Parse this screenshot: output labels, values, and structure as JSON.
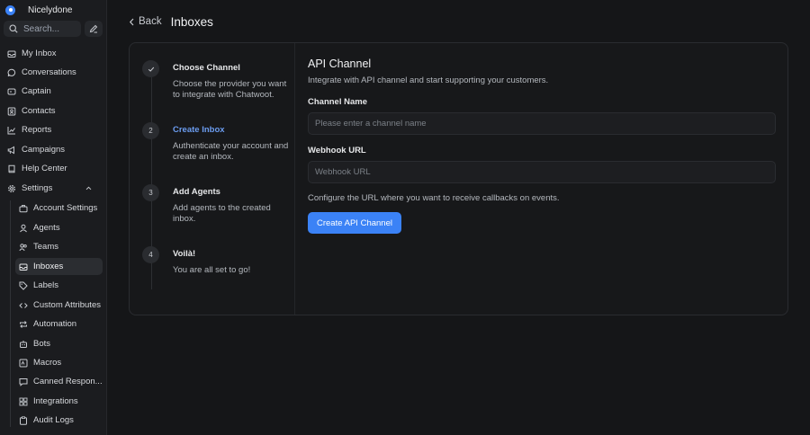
{
  "sidebar": {
    "brand_name": "Nicelydone",
    "search_placeholder": "Search...",
    "nav": [
      {
        "label": "My Inbox",
        "icon": "inbox-icon"
      },
      {
        "label": "Conversations",
        "icon": "chat-icon"
      },
      {
        "label": "Captain",
        "icon": "captain-icon"
      },
      {
        "label": "Contacts",
        "icon": "contacts-icon"
      },
      {
        "label": "Reports",
        "icon": "reports-icon"
      },
      {
        "label": "Campaigns",
        "icon": "megaphone-icon"
      },
      {
        "label": "Help Center",
        "icon": "book-icon"
      },
      {
        "label": "Settings",
        "icon": "gear-icon"
      }
    ],
    "settings_items": [
      {
        "label": "Account Settings",
        "icon": "briefcase-icon"
      },
      {
        "label": "Agents",
        "icon": "user-icon"
      },
      {
        "label": "Teams",
        "icon": "users-icon"
      },
      {
        "label": "Inboxes",
        "icon": "inbox-tray-icon"
      },
      {
        "label": "Labels",
        "icon": "tag-icon"
      },
      {
        "label": "Custom Attributes",
        "icon": "code-icon"
      },
      {
        "label": "Automation",
        "icon": "repeat-icon"
      },
      {
        "label": "Bots",
        "icon": "bot-icon"
      },
      {
        "label": "Macros",
        "icon": "macro-icon"
      },
      {
        "label": "Canned Respon...",
        "icon": "message-icon"
      },
      {
        "label": "Integrations",
        "icon": "grid-icon"
      },
      {
        "label": "Audit Logs",
        "icon": "clipboard-icon"
      }
    ],
    "active_item": "Inboxes"
  },
  "header": {
    "back_label": "Back",
    "title": "Inboxes"
  },
  "steps": [
    {
      "number": "",
      "title": "Choose Channel",
      "description": "Choose the provider you want to integrate with Chatwoot.",
      "state": "done"
    },
    {
      "number": "2",
      "title": "Create Inbox",
      "description": "Authenticate your account and create an inbox.",
      "state": "active"
    },
    {
      "number": "3",
      "title": "Add Agents",
      "description": "Add agents to the created inbox.",
      "state": "pending"
    },
    {
      "number": "4",
      "title": "Voilà!",
      "description": "You are all set to go!",
      "state": "pending"
    }
  ],
  "form": {
    "title": "API Channel",
    "subtitle": "Integrate with API channel and start supporting your customers.",
    "channel_name_label": "Channel Name",
    "channel_name_placeholder": "Please enter a channel name",
    "channel_name_value": "",
    "webhook_label": "Webhook URL",
    "webhook_placeholder": "Webhook URL",
    "webhook_value": "",
    "webhook_help": "Configure the URL where you want to receive callbacks on events.",
    "submit_label": "Create API Channel"
  },
  "colors": {
    "accent": "#3b82f6",
    "active_step": "#6b9cf0",
    "background": "#151618"
  }
}
